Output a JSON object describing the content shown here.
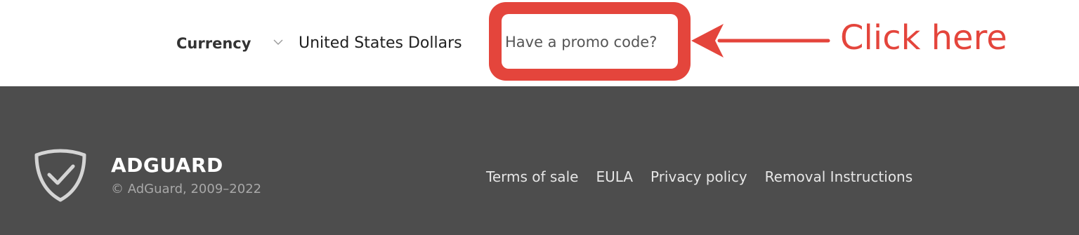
{
  "currency": {
    "label": "Currency",
    "selected_value": "United States Dollars",
    "chevron_icon": "chevron-down-icon"
  },
  "promo": {
    "link_text": "Have a promo code?"
  },
  "annotation": {
    "text": "Click here",
    "color": "#e4453c",
    "arrow_icon": "arrow-left-icon"
  },
  "footer": {
    "background_color": "#4d4d4d",
    "logo_icon": "shield-check-icon",
    "brand": "ADGUARD",
    "copyright": "© AdGuard, 2009–2022",
    "links": [
      {
        "label": "Terms of sale"
      },
      {
        "label": "EULA"
      },
      {
        "label": "Privacy policy"
      },
      {
        "label": "Removal Instructions"
      }
    ]
  }
}
